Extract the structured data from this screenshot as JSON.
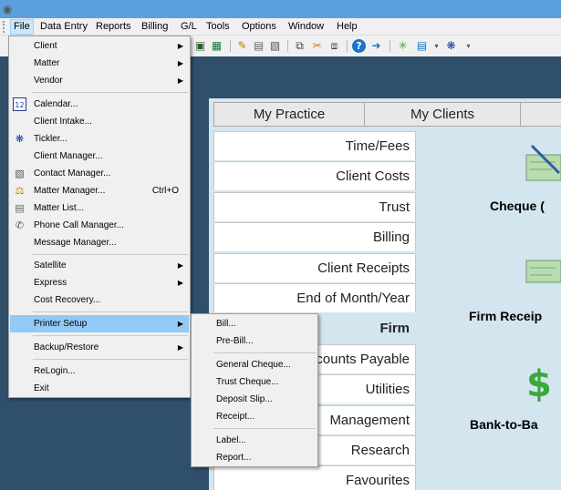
{
  "titlebar": {
    "icon": "app-icon"
  },
  "menubar": {
    "items": [
      "File",
      "Data Entry",
      "Reports",
      "Billing",
      "G/L",
      "Tools",
      "Options",
      "Window",
      "Help"
    ]
  },
  "toolbar": {
    "icons": [
      "book-icon",
      "book-green-icon",
      "notepad-icon",
      "notes-icon",
      "calculator-icon",
      "copy-icon",
      "cut-icon",
      "paste-icon",
      "help-icon",
      "whats-this-icon",
      "star-icon",
      "window-icon",
      "people-icon"
    ]
  },
  "tabs": [
    "My Practice",
    "My Clients",
    ""
  ],
  "sidebar": {
    "items": [
      "Time/Fees",
      "Client Costs",
      "Trust",
      "Billing",
      "Client Receipts",
      "End of Month/Year",
      "Firm",
      "Accounts Payable",
      "Utilities",
      "Management",
      "Research",
      "Favourites"
    ],
    "selected": "Firm"
  },
  "content": {
    "items": [
      "Cheque (",
      "Firm Receip",
      "Bank-to-Ba"
    ]
  },
  "file_menu": {
    "items": [
      {
        "label": "Client",
        "arrow": true
      },
      {
        "label": "Matter",
        "arrow": true
      },
      {
        "label": "Vendor",
        "arrow": true
      },
      {
        "label": "Calendar...",
        "icon": "calendar-icon"
      },
      {
        "label": "Client Intake..."
      },
      {
        "label": "Tickler...",
        "icon": "tickler-icon"
      },
      {
        "label": "Client Manager..."
      },
      {
        "label": "Contact Manager...",
        "icon": "contact-icon"
      },
      {
        "label": "Matter Manager...",
        "icon": "scales-icon",
        "shortcut": "Ctrl+O"
      },
      {
        "label": "Matter List...",
        "icon": "list-icon"
      },
      {
        "label": "Phone Call Manager...",
        "icon": "phone-icon"
      },
      {
        "label": "Message Manager..."
      },
      {
        "label": "Satellite",
        "arrow": true
      },
      {
        "label": "Express",
        "arrow": true
      },
      {
        "label": "Cost Recovery..."
      },
      {
        "label": "Printer Setup",
        "arrow": true
      },
      {
        "label": "Backup/Restore",
        "arrow": true
      },
      {
        "label": "ReLogin..."
      },
      {
        "label": "Exit"
      }
    ]
  },
  "printer_submenu": {
    "items": [
      "Bill...",
      "Pre-Bill...",
      "General Cheque...",
      "Trust Cheque...",
      "Deposit Slip...",
      "Receipt...",
      "Label...",
      "Report..."
    ]
  },
  "colors": {
    "highlight": "#91c9f7",
    "panel": "#d3e5ef",
    "background": "#2f4f6b",
    "titlebar": "#5aa0dc"
  }
}
